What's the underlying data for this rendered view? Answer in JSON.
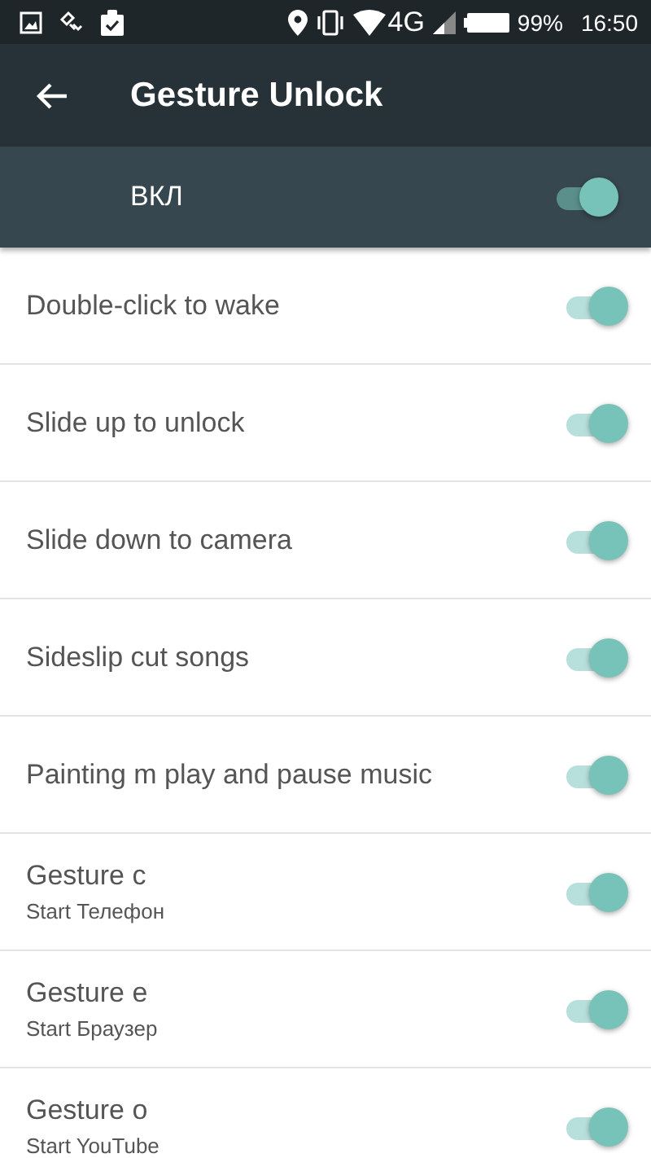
{
  "status_bar": {
    "network": "4G",
    "battery": "99%",
    "time": "16:50"
  },
  "app_bar": {
    "title": "Gesture Unlock"
  },
  "master_switch": {
    "label": "ВКЛ",
    "on": true
  },
  "settings": [
    {
      "title": "Double-click to wake",
      "on": true
    },
    {
      "title": "Slide up to unlock",
      "on": true
    },
    {
      "title": "Slide down to camera",
      "on": true
    },
    {
      "title": "Sideslip cut songs",
      "on": true
    },
    {
      "title": "Painting m play and pause music",
      "on": true
    },
    {
      "title": "Gesture c",
      "subtitle": "Start Телефон",
      "on": true
    },
    {
      "title": "Gesture e",
      "subtitle": "Start Браузер",
      "on": true
    },
    {
      "title": "Gesture o",
      "subtitle": "Start YouTube",
      "on": true
    }
  ]
}
